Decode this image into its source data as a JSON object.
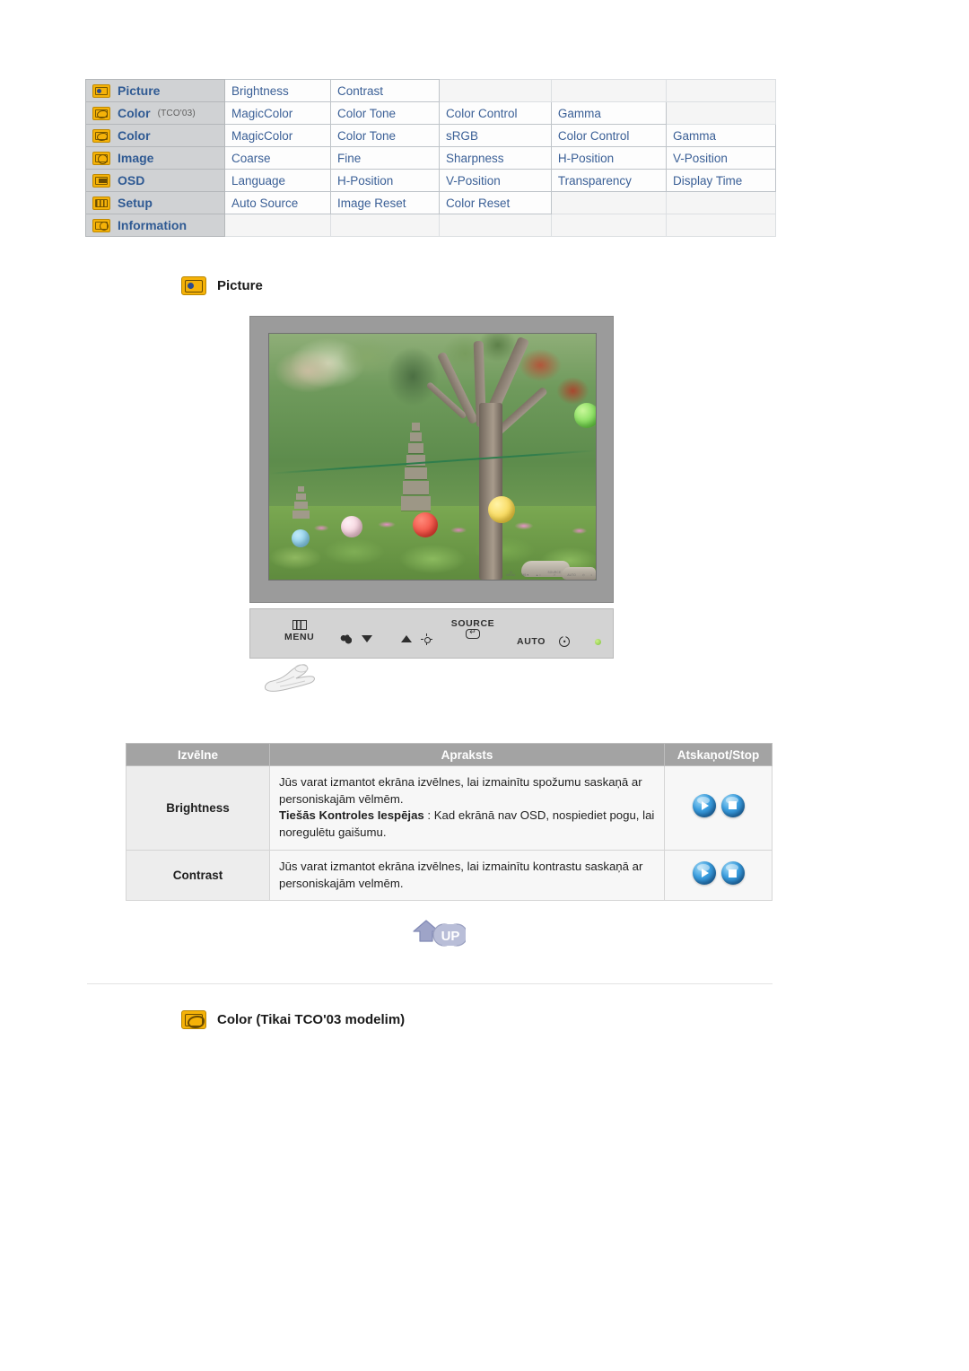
{
  "nav_table": {
    "rows": [
      {
        "icon": "picture-icon",
        "category": "Picture",
        "sub": "",
        "items": [
          "Brightness",
          "Contrast",
          "",
          "",
          ""
        ]
      },
      {
        "icon": "color-icon",
        "category": "Color",
        "sub": "(TCO'03)",
        "items": [
          "MagicColor",
          "Color Tone",
          "Color Control",
          "Gamma",
          ""
        ]
      },
      {
        "icon": "color-icon",
        "category": "Color",
        "sub": "",
        "items": [
          "MagicColor",
          "Color Tone",
          "sRGB",
          "Color Control",
          "Gamma"
        ]
      },
      {
        "icon": "image-icon",
        "category": "Image",
        "sub": "",
        "items": [
          "Coarse",
          "Fine",
          "Sharpness",
          "H-Position",
          "V-Position"
        ]
      },
      {
        "icon": "osd-icon",
        "category": "OSD",
        "sub": "",
        "items": [
          "Language",
          "H-Position",
          "V-Position",
          "Transparency",
          "Display Time"
        ]
      },
      {
        "icon": "setup-icon",
        "category": "Setup",
        "sub": "",
        "items": [
          "Auto Source",
          "Image Reset",
          "Color Reset",
          "",
          ""
        ]
      },
      {
        "icon": "information-icon",
        "category": "Information",
        "sub": "",
        "items": [
          "",
          "",
          "",
          "",
          ""
        ]
      }
    ]
  },
  "section_picture": {
    "icon": "picture-icon",
    "title": "Picture"
  },
  "monitor": {
    "controls": [
      {
        "name": "menu",
        "label": "MENU",
        "glyph": "menu-bars-icon"
      },
      {
        "name": "magicbright",
        "label": "",
        "glyph": "magicbright-icon"
      },
      {
        "name": "down",
        "label": "",
        "glyph": "triangle-down-icon"
      },
      {
        "name": "up",
        "label": "",
        "glyph": "triangle-up-icon"
      },
      {
        "name": "brightness",
        "label": "",
        "glyph": "brightness-sun-icon"
      },
      {
        "name": "source",
        "label": "SOURCE",
        "glyph": "enter-icon"
      },
      {
        "name": "auto",
        "label": "AUTO",
        "glyph": ""
      },
      {
        "name": "power",
        "label": "",
        "glyph": "power-icon"
      },
      {
        "name": "led",
        "label": "",
        "glyph": "power-led-indicator"
      }
    ],
    "osd_ghost": [
      {
        "top": "III",
        "bottom": "MENU"
      },
      {
        "top": "",
        "bottom": "MB▼"
      },
      {
        "top": "",
        "bottom": "▲☼"
      },
      {
        "top": "SOURCE",
        "bottom": "⏎"
      },
      {
        "top": "",
        "bottom": "AUTO"
      },
      {
        "top": "",
        "bottom": "⏻"
      },
      {
        "top": "",
        "bottom": "•"
      }
    ]
  },
  "desc_table": {
    "headers": {
      "menu": "Izvēlne",
      "description": "Apraksts",
      "playstop": "Atskaņot/Stop"
    },
    "rows": [
      {
        "menu": "Brightness",
        "line1": "Jūs varat izmantot ekrāna izvēlnes, lai izmainītu spožumu saskaņā ar personiskajām vēlmēm.",
        "bold": "Tiešās Kontroles Iespējas",
        "line2": " : Kad ekrānā nav OSD, nospiediet pogu, lai noregulētu gaišumu.",
        "play": "play-button-icon",
        "stop": "stop-button-icon"
      },
      {
        "menu": "Contrast",
        "line1": "Jūs varat izmantot ekrāna izvēlnes, lai izmainītu kontrastu saskaņā ar personiskajām velmēm.",
        "bold": "",
        "line2": "",
        "play": "play-button-icon",
        "stop": "stop-button-icon"
      }
    ]
  },
  "up_button": {
    "label": "UP",
    "icon": "up-arrow-icon"
  },
  "section_color": {
    "icon": "color-icon",
    "title": "Color (Tikai TCO'03 modelim)"
  },
  "colors": {
    "nav_text": "#3a5f96",
    "nav_category_bg": "#d0d2d4",
    "icon_gold": "#f5b208",
    "desc_header_bg": "#a3a3a3",
    "orb_blue": "#3b9fe0"
  }
}
